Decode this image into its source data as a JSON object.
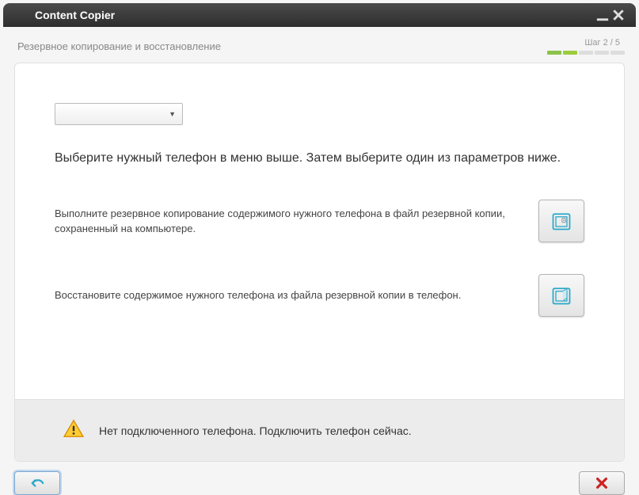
{
  "titlebar": {
    "title": "Content Copier"
  },
  "subheader": {
    "subtitle": "Резервное копирование и восстановление",
    "step_label": "Шаг 2 / 5"
  },
  "panel": {
    "dropdown_value": "",
    "instruction": "Выберите нужный телефон в меню выше. Затем выберите один из параметров ниже.",
    "backup_text": "Выполните резервное копирование содержимого нужного телефона в файл резервной копии, сохраненный на компьютере.",
    "restore_text": "Восстановите содержимое нужного телефона из файла резервной копии в телефон."
  },
  "status": {
    "message": "Нет подключенного телефона. Подключить телефон сейчас."
  },
  "icons": {
    "backup": "safe-lock-icon",
    "restore": "safe-open-icon",
    "warning": "warning-triangle-icon",
    "back": "back-arrow-icon",
    "cancel": "cancel-x-icon"
  },
  "step": {
    "total": 5,
    "current": 2
  }
}
